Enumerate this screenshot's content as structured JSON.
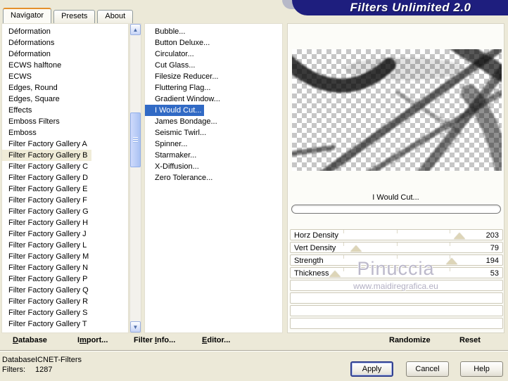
{
  "window": {
    "title": "Filters Unlimited 2.0"
  },
  "tabs": [
    {
      "label": "Navigator",
      "active": true
    },
    {
      "label": "Presets",
      "active": false
    },
    {
      "label": "About",
      "active": false
    }
  ],
  "categories": {
    "items": [
      "Déformation",
      "Déformations",
      "Déformation",
      "ECWS halftone",
      "ECWS",
      "Edges, Round",
      "Edges, Square",
      "Effects",
      "Emboss Filters",
      "Emboss",
      "Filter Factory Gallery A",
      "Filter Factory Gallery B",
      "Filter Factory Gallery C",
      "Filter Factory Gallery D",
      "Filter Factory Gallery E",
      "Filter Factory Gallery F",
      "Filter Factory Gallery G",
      "Filter Factory Gallery H",
      "Filter Factory Gallery J",
      "Filter Factory Gallery L",
      "Filter Factory Gallery M",
      "Filter Factory Gallery N",
      "Filter Factory Gallery P",
      "Filter Factory Gallery Q",
      "Filter Factory Gallery R",
      "Filter Factory Gallery S",
      "Filter Factory Gallery T"
    ],
    "selected_index": 11
  },
  "filters": {
    "items": [
      "Bubble...",
      "Button Deluxe...",
      "Circulator...",
      "Cut Glass...",
      "Filesize Reducer...",
      "Fluttering Flag...",
      "Gradient Window...",
      "I Would Cut...",
      "James Bondage...",
      "Seismic Twirl...",
      "Spinner...",
      "Starmaker...",
      "X-Diffusion...",
      "Zero Tolerance..."
    ],
    "selected_index": 7
  },
  "preview": {
    "filter_name": "I Would Cut...",
    "progress_percent": 0
  },
  "sliders": {
    "max": 255,
    "items": [
      {
        "label": "Horz Density",
        "value": 203
      },
      {
        "label": "Vert Density",
        "value": 79
      },
      {
        "label": "Strength",
        "value": 194
      },
      {
        "label": "Thickness",
        "value": 53
      }
    ],
    "empty_rows": 4
  },
  "watermark": {
    "name": "Pinuccia",
    "site": "www.maidiregrafica.eu"
  },
  "toolbar": {
    "database": {
      "pre": "",
      "key": "D",
      "post": "atabase"
    },
    "import": {
      "pre": "I",
      "key": "m",
      "post": "port..."
    },
    "filter_info": {
      "pre": "Filter ",
      "key": "I",
      "post": "nfo..."
    },
    "editor": {
      "pre": "",
      "key": "E",
      "post": "ditor..."
    },
    "randomize": "Randomize",
    "reset": "Reset"
  },
  "status": {
    "database_label": "Database:",
    "database_value": "ICNET-Filters",
    "filters_label": "Filters:",
    "filters_value": "1287"
  },
  "buttons": {
    "apply": "Apply",
    "cancel": "Cancel",
    "help": "Help"
  },
  "colors": {
    "banner_navy": "#1e1e7e",
    "tab_accent_orange": "#e5902a",
    "selection_blue": "#316ac5",
    "category_selection_beige": "#f0ecd8",
    "dialog_beige": "#ece9d8",
    "slider_thumb_tan": "#ddd5b8"
  }
}
